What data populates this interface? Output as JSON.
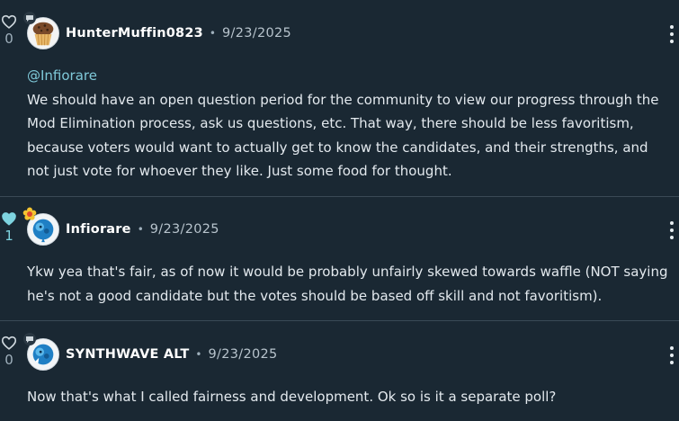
{
  "comments": [
    {
      "username": "HunterMuffin0823",
      "separator": "•",
      "date": "9/23/2025",
      "likes": "0",
      "liked": false,
      "mention": "@Infiorare",
      "text": "We should have an open question period for the community to view our progress through the Mod Elimination process, ask us questions, etc. That way, there should be less favoritism, because voters would want to actually get to know the candidates, and their strengths, and not just vote for whoever they like. Just some food for thought.",
      "avatar_icon": "muffin-avatar-icon",
      "badge_icon": "speech-bubble-badge-icon"
    },
    {
      "username": "Infiorare",
      "separator": "•",
      "date": "9/23/2025",
      "likes": "1",
      "liked": true,
      "text": "Ykw yea that's fair, as of now it would be probably unfairly skewed towards waffle (NOT saying he's not a good candidate but the votes should be based off skill and not favoritism).",
      "avatar_icon": "blue-creature-avatar-icon",
      "badge_icon": "flower-badge-icon"
    },
    {
      "username": "SYNTHWAVE ALT",
      "separator": "•",
      "date": "9/23/2025",
      "likes": "0",
      "liked": false,
      "text": "Now that's what I called fairness and development. Ok so is it a separate poll?",
      "avatar_icon": "blue-creature-avatar-icon",
      "badge_icon": "speech-bubble-badge-icon"
    }
  ],
  "colors": {
    "background": "#1a2833",
    "mention": "#7fc9d9",
    "liked_heart": "#7ed4e0",
    "divider": "#3a4a56"
  }
}
